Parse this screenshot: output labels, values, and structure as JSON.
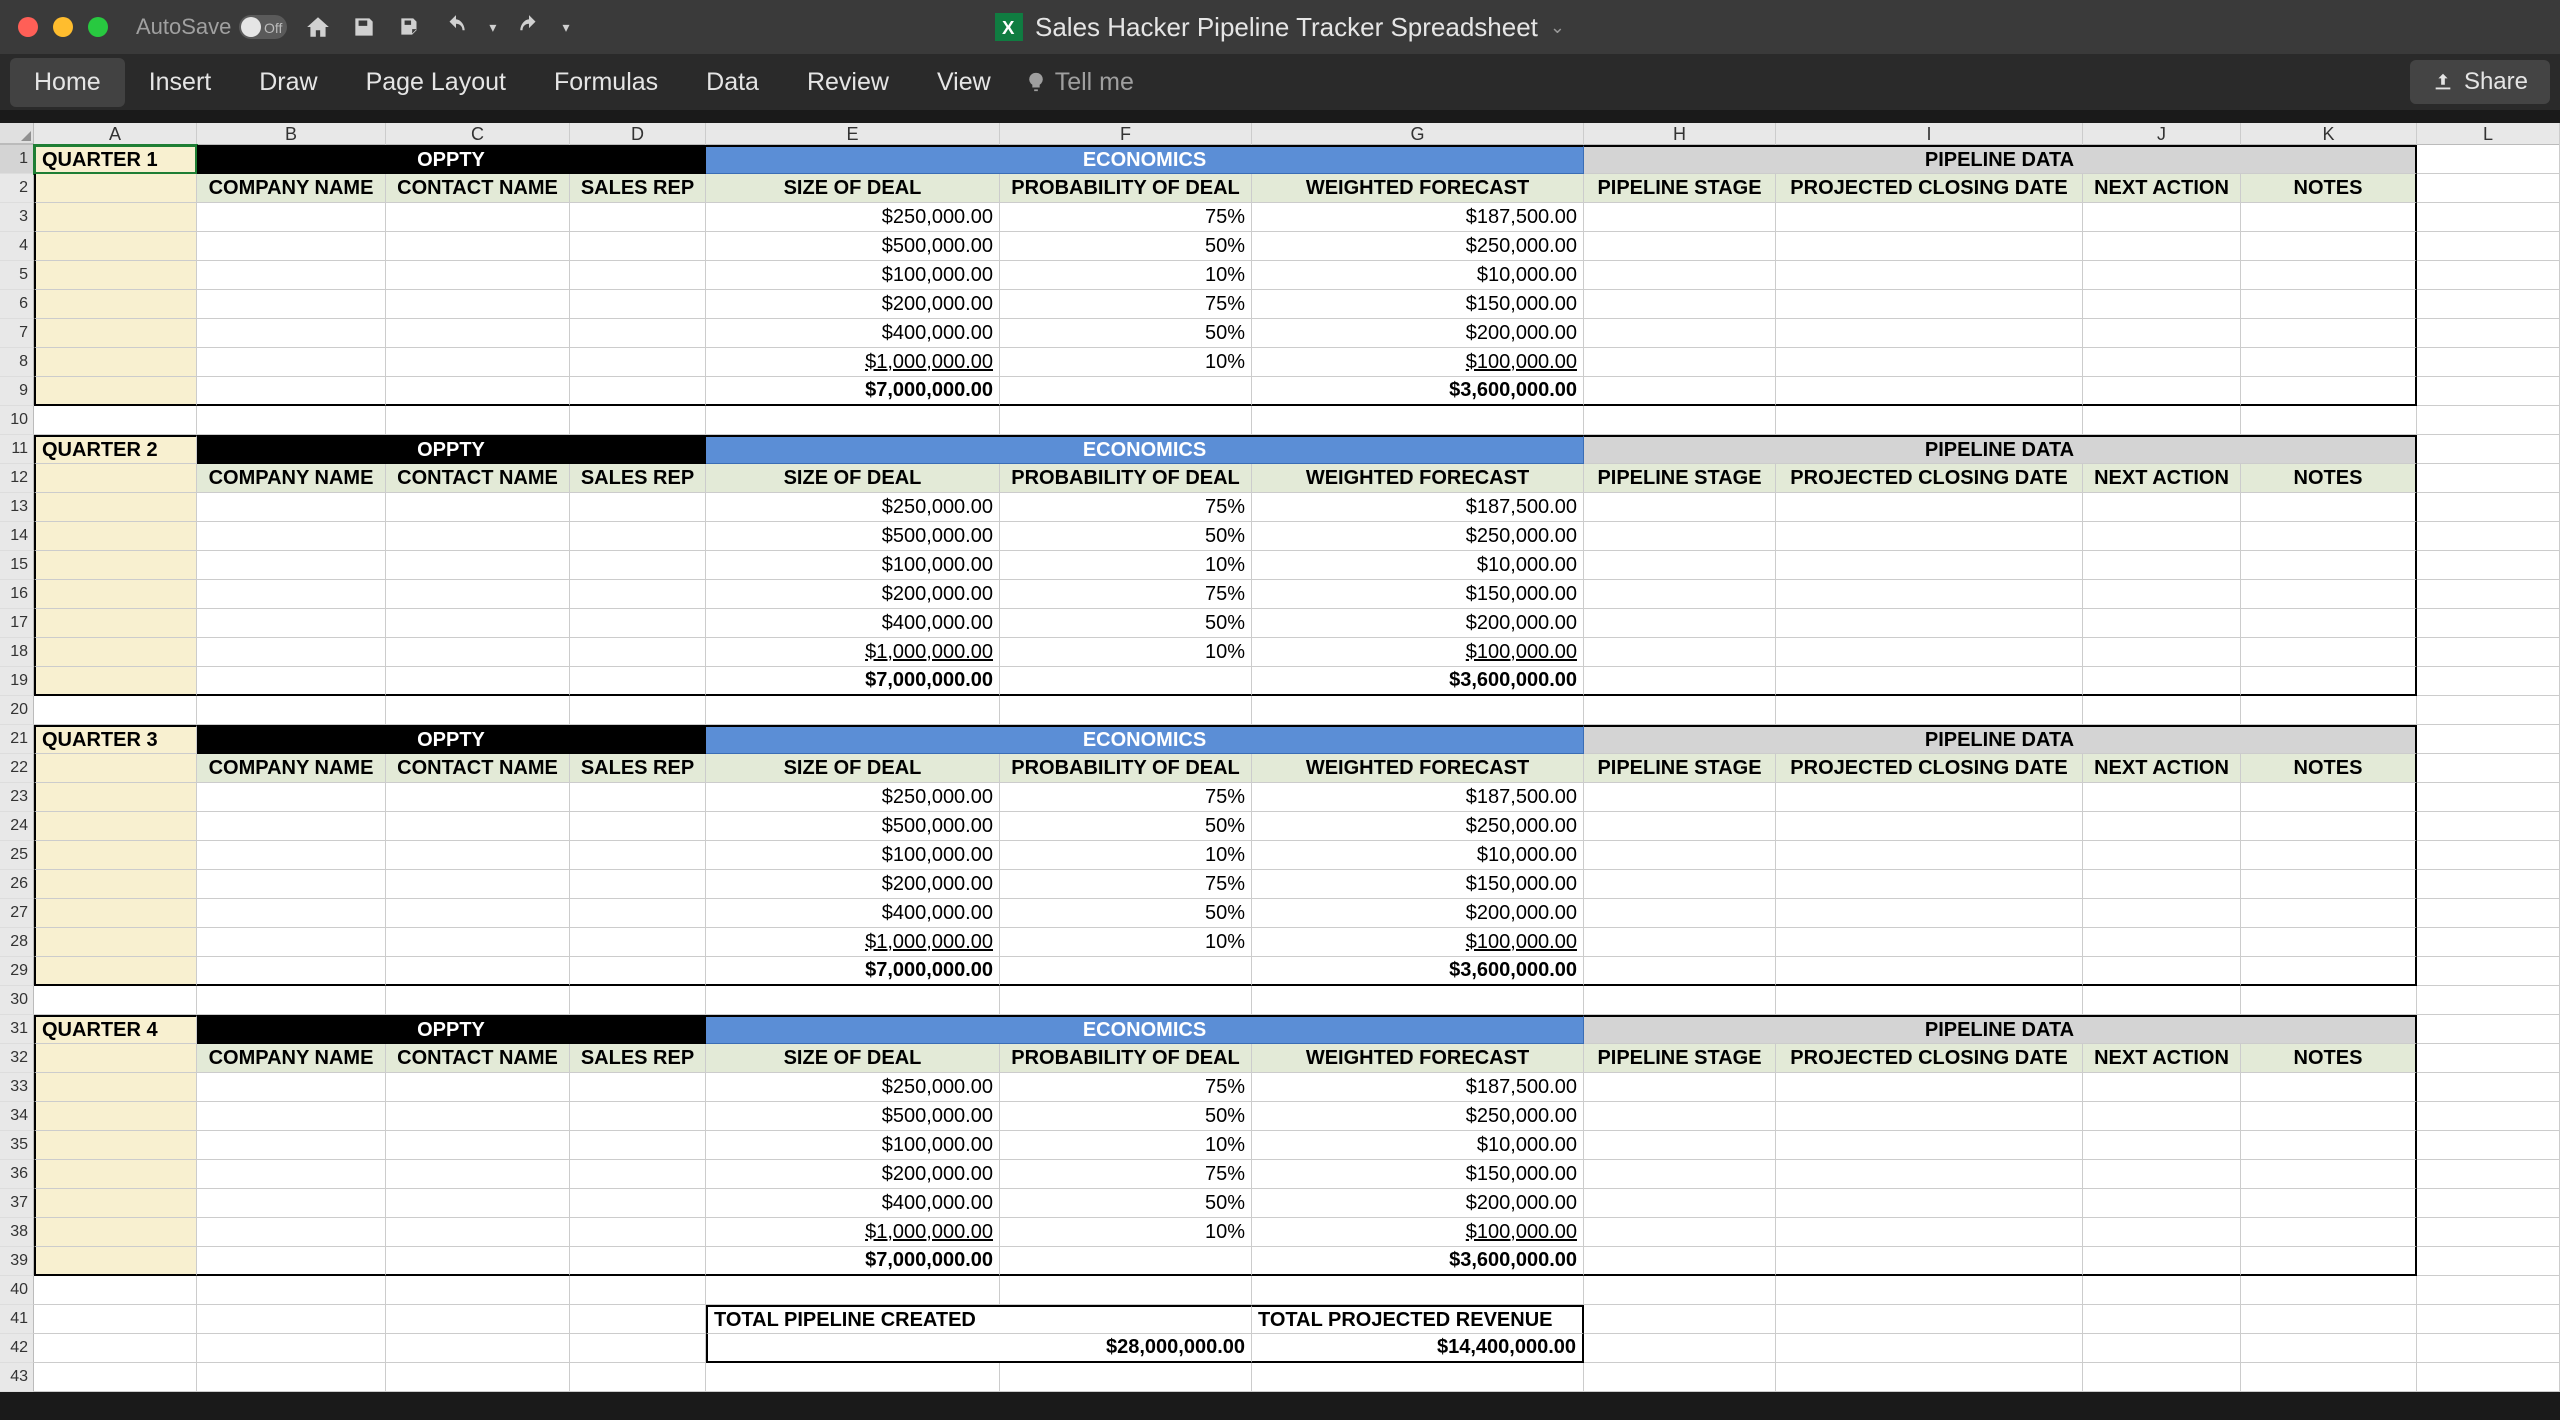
{
  "window": {
    "autosave": "AutoSave",
    "autosave_state": "Off",
    "title": "Sales Hacker Pipeline Tracker Spreadsheet"
  },
  "ribbon": {
    "tabs": [
      "Home",
      "Insert",
      "Draw",
      "Page Layout",
      "Formulas",
      "Data",
      "Review",
      "View"
    ],
    "tellme": "Tell me",
    "share": "Share"
  },
  "columns": [
    "A",
    "B",
    "C",
    "D",
    "E",
    "F",
    "G",
    "H",
    "I",
    "J",
    "K",
    "L"
  ],
  "row_count": 43,
  "section_title": {
    "oppty": "OPPTY",
    "econ": "ECONOMICS",
    "pdata": "PIPELINE DATA"
  },
  "subhead": {
    "company": "COMPANY NAME",
    "contact": "CONTACT NAME",
    "rep": "SALES REP",
    "size": "SIZE OF DEAL",
    "prob": "PROBABILITY OF DEAL",
    "weighted": "WEIGHTED FORECAST",
    "stage": "PIPELINE STAGE",
    "close": "PROJECTED CLOSING DATE",
    "next": "NEXT ACTION",
    "notes": "NOTES"
  },
  "quarters": [
    {
      "name": "QUARTER 1"
    },
    {
      "name": "QUARTER 2"
    },
    {
      "name": "QUARTER 3"
    },
    {
      "name": "QUARTER 4"
    }
  ],
  "deals": [
    {
      "size": "$250,000.00",
      "prob": "75%",
      "weighted": "$187,500.00"
    },
    {
      "size": "$500,000.00",
      "prob": "50%",
      "weighted": "$250,000.00"
    },
    {
      "size": "$100,000.00",
      "prob": "10%",
      "weighted": "$10,000.00"
    },
    {
      "size": "$200,000.00",
      "prob": "75%",
      "weighted": "$150,000.00"
    },
    {
      "size": "$400,000.00",
      "prob": "50%",
      "weighted": "$200,000.00"
    },
    {
      "size": "$1,000,000.00",
      "prob": "10%",
      "weighted": "$100,000.00",
      "underline": true
    }
  ],
  "quarter_totals": {
    "size": "$7,000,000.00",
    "weighted": "$3,600,000.00"
  },
  "summary": {
    "pipe_label": "TOTAL PIPELINE CREATED",
    "pipe_val": "$28,000,000.00",
    "rev_label": "TOTAL PROJECTED REVENUE",
    "rev_val": "$14,400,000.00"
  }
}
